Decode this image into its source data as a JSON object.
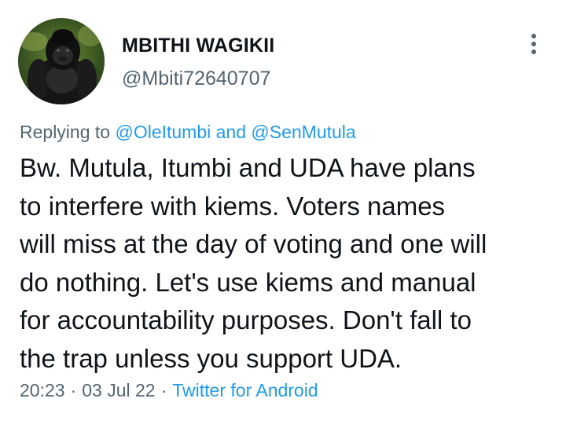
{
  "author": {
    "display_name": "MBITHI WAGIKII",
    "handle": "@Mbiti72640707",
    "avatar_icon": "gorilla-avatar"
  },
  "menu": {
    "icon": "more-vertical-icon"
  },
  "reply": {
    "prefix": "Replying to",
    "user1": "@OleItumbi",
    "joiner": "and",
    "user2": "@SenMutula"
  },
  "tweet": {
    "lines": [
      "Bw. Mutula, Itumbi and UDA have plans",
      "to interfere with kiems. Voters names",
      "will miss at the day of voting and one will",
      "do nothing. Let's use kiems and manual",
      "for accountability purposes. Don't fall to",
      "the trap unless you support UDA."
    ]
  },
  "meta": {
    "time": "20:23",
    "separator": "·",
    "date": "03 Jul 22",
    "source": "Twitter for Android"
  },
  "colors": {
    "text": "#0f1419",
    "secondary": "#536471",
    "link": "#1d9bf0"
  }
}
